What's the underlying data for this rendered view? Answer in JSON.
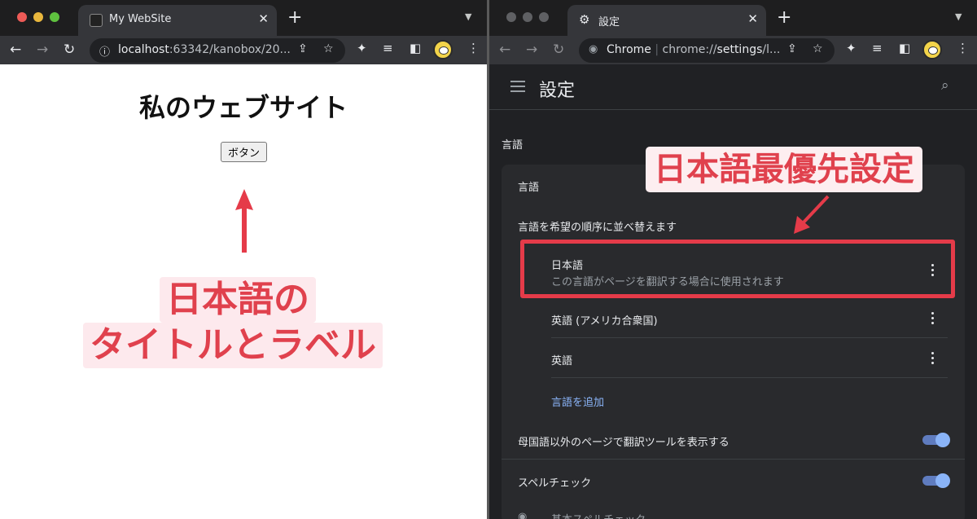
{
  "left_window": {
    "tab_title": "My WebSite",
    "url_host": "localhost",
    "url_rest": ":63342/kanobox/20...",
    "page": {
      "heading": "私のウェブサイト",
      "button_label": "ボタン"
    },
    "annotation": {
      "line1": "日本語の",
      "line2": "タイトルとラベル"
    }
  },
  "right_window": {
    "tab_title": "設定",
    "url_chip": "Chrome",
    "url_scheme": "chrome://",
    "url_path_bold": "settings",
    "url_rest": "/l...",
    "header_title": "設定",
    "section_label": "言語",
    "card": {
      "title": "言語",
      "order_label": "言語を希望の順序に並べ替えます",
      "languages": [
        {
          "name": "日本語",
          "sub": "この言語がページを翻訳する場合に使用されます"
        },
        {
          "name": "英語 (アメリカ合衆国)",
          "sub": ""
        },
        {
          "name": "英語",
          "sub": ""
        }
      ],
      "add_language": "言語を追加",
      "translate_setting": "母国語以外のページで翻訳ツールを表示する",
      "spellcheck_setting": "スペルチェック",
      "partial_bottom": "基本スペルチェック"
    },
    "annotation": "日本語最優先設定"
  },
  "colors": {
    "annotation_red": "#e0414d",
    "highlight_border": "#e53b49",
    "link_blue": "#8ab4f8",
    "toggle_on": "#8ab4f8"
  }
}
